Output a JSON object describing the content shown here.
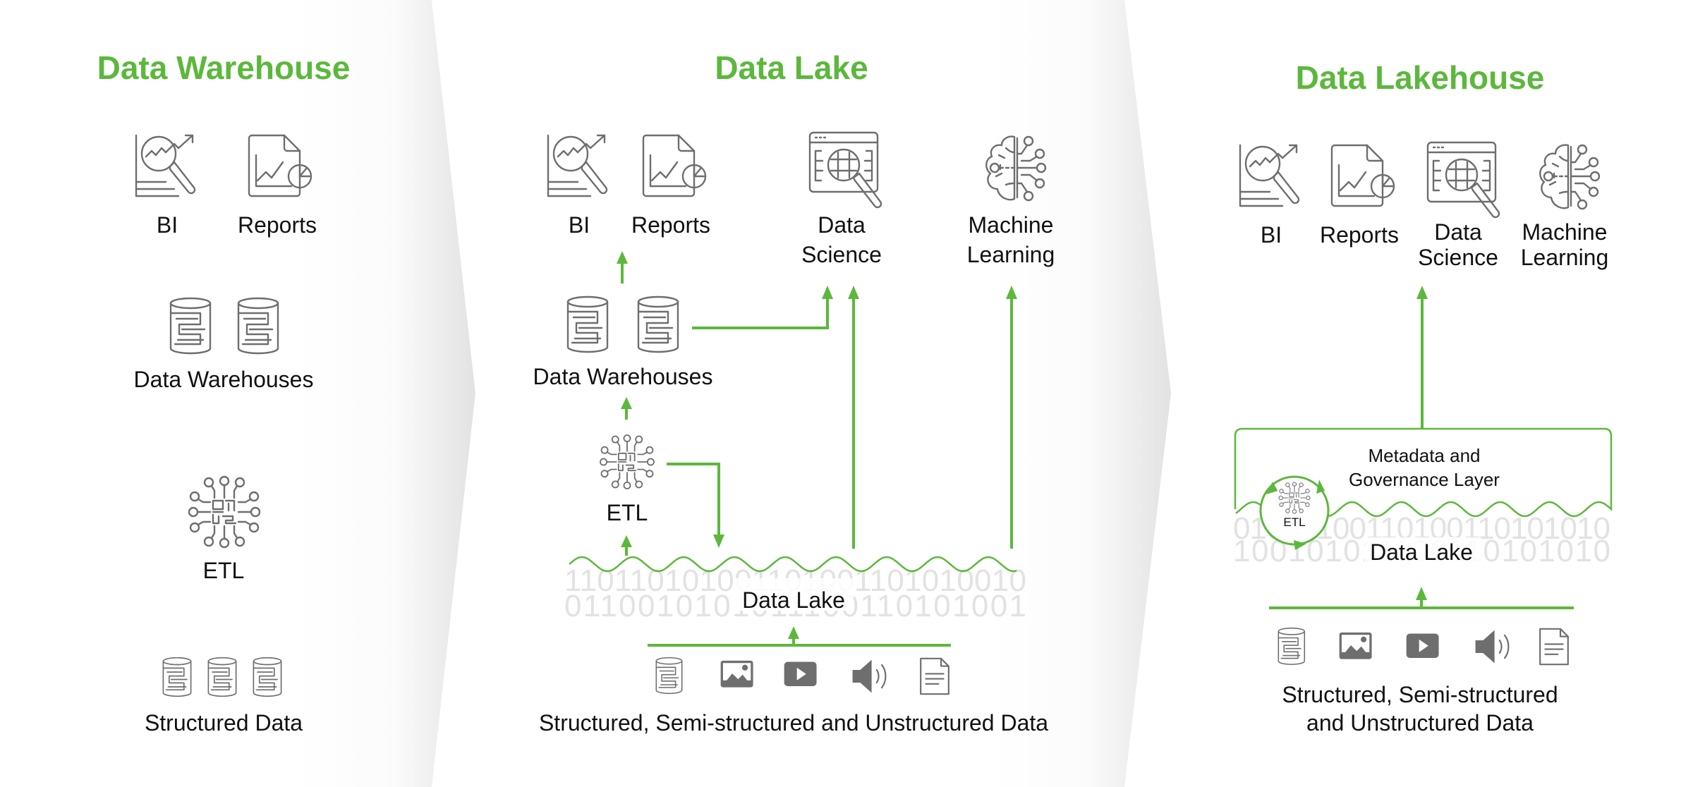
{
  "colors": {
    "accent": "#5cb83c",
    "icon": "#6e6e6e",
    "text": "#111111",
    "binary": "#e2e2e2",
    "panel_shadow": "#e4e4e4"
  },
  "panels": {
    "warehouse": {
      "title": "Data Warehouse",
      "consumers": [
        {
          "icon": "bi-icon",
          "label": "BI"
        },
        {
          "icon": "reports-icon",
          "label": "Reports"
        }
      ],
      "storage": {
        "icon": "database-icon",
        "count": 2,
        "label": "Data Warehouses"
      },
      "etl": {
        "icon": "etl-chip-icon",
        "label": "ETL"
      },
      "source": {
        "icon": "database-icon",
        "count": 3,
        "label": "Structured Data"
      }
    },
    "lake": {
      "title": "Data Lake",
      "consumers": [
        {
          "icon": "bi-icon",
          "label": "BI"
        },
        {
          "icon": "reports-icon",
          "label": "Reports"
        },
        {
          "icon": "data-science-icon",
          "label_line1": "Data",
          "label_line2": "Science"
        },
        {
          "icon": "machine-learning-icon",
          "label_line1": "Machine",
          "label_line2": "Learning"
        }
      ],
      "storage": {
        "icon": "database-icon",
        "count": 2,
        "label": "Data Warehouses"
      },
      "etl": {
        "icon": "etl-chip-icon",
        "label": "ETL"
      },
      "lake_label": "Data Lake",
      "binary_row1": "110110101001101001101010010",
      "binary_row2": "0110010101011100110101001",
      "sources": [
        "database-icon",
        "image-icon",
        "video-play-icon",
        "audio-speaker-icon",
        "document-icon"
      ],
      "source_label": "Structured, Semi-structured and Unstructured Data"
    },
    "lakehouse": {
      "title": "Data Lakehouse",
      "consumers": [
        {
          "icon": "bi-icon",
          "label": "BI"
        },
        {
          "icon": "reports-icon",
          "label": "Reports"
        },
        {
          "icon": "data-science-icon",
          "label_line1": "Data",
          "label_line2": "Science"
        },
        {
          "icon": "machine-learning-icon",
          "label_line1": "Machine",
          "label_line2": "Learning"
        }
      ],
      "metadata_line1": "Metadata and",
      "metadata_line2": "Governance Layer",
      "etl_label": "ETL",
      "lake_label": "Data Lake",
      "binary_row1": "01010100110100110101010",
      "binary_row2": "100101011100110101010",
      "sources": [
        "database-icon",
        "image-icon",
        "video-play-icon",
        "audio-speaker-icon",
        "document-icon"
      ],
      "source_label_line1": "Structured, Semi-structured",
      "source_label_line2": "and Unstructured Data"
    }
  }
}
